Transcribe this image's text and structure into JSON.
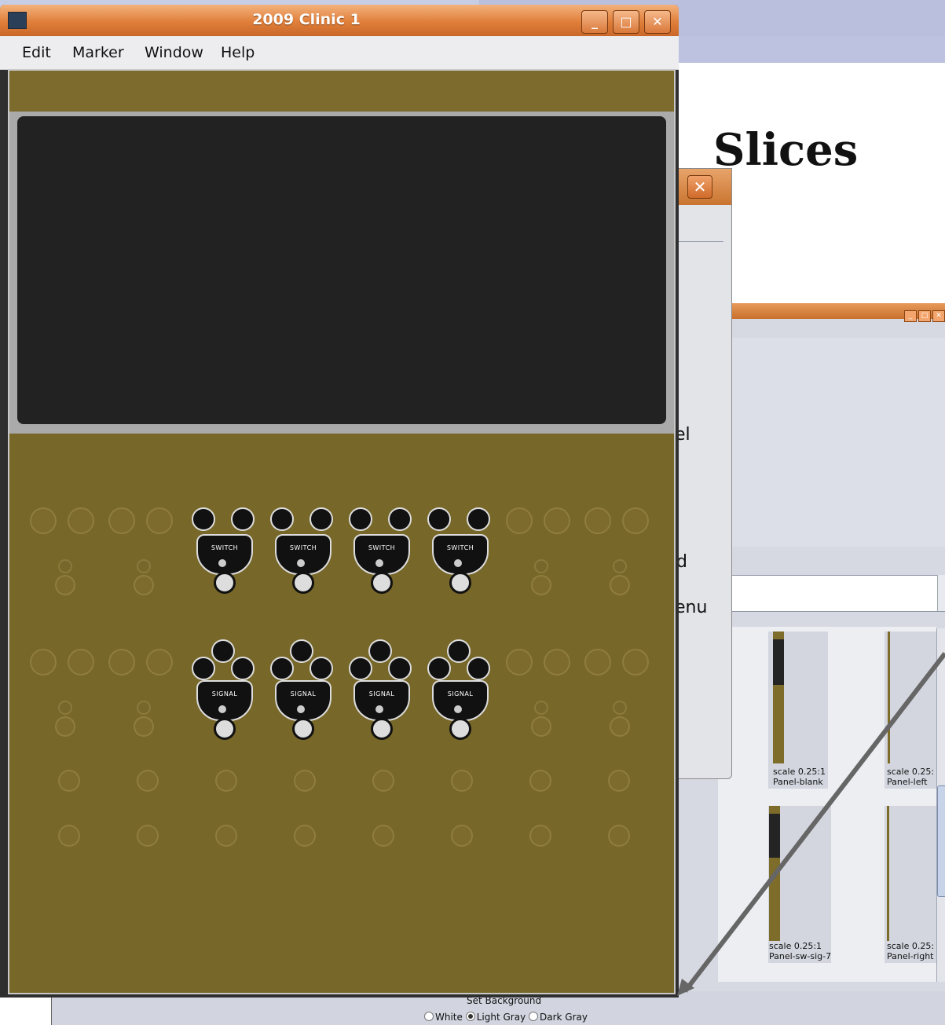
{
  "slide": {
    "title": "Slices"
  },
  "dialog2": {
    "close_glyph": "✕",
    "text_fragments": [
      "el",
      "d",
      "enu"
    ]
  },
  "palette": {
    "tiles": [
      {
        "scale": "scale 0.25:1",
        "name": "Panel-blank"
      },
      {
        "scale": "scale 0.25:",
        "name": "Panel-left"
      },
      {
        "scale": "scale 0.25:1",
        "name": "Panel-sw-sig-7"
      },
      {
        "scale": "scale 0.25:",
        "name": "Panel-right"
      }
    ]
  },
  "background_control": {
    "label": "Set Background",
    "options": [
      {
        "label": "White",
        "selected": false
      },
      {
        "label": "Light Gray",
        "selected": true
      },
      {
        "label": "Dark Gray",
        "selected": false
      }
    ]
  },
  "main_window": {
    "title": "2009 Clinic 1",
    "menu": [
      "Edit",
      "Marker",
      "Window",
      "Help"
    ],
    "title_buttons": {
      "minimize": "_",
      "maximize": "□",
      "close": "✕"
    },
    "plates": {
      "switch_label": "SWITCH",
      "signal_label": "SIGNAL"
    }
  },
  "colors": {
    "titlebar": "#e07f3a",
    "panel": "#776729",
    "screen": "#222222",
    "menubar": "#ededf0"
  }
}
